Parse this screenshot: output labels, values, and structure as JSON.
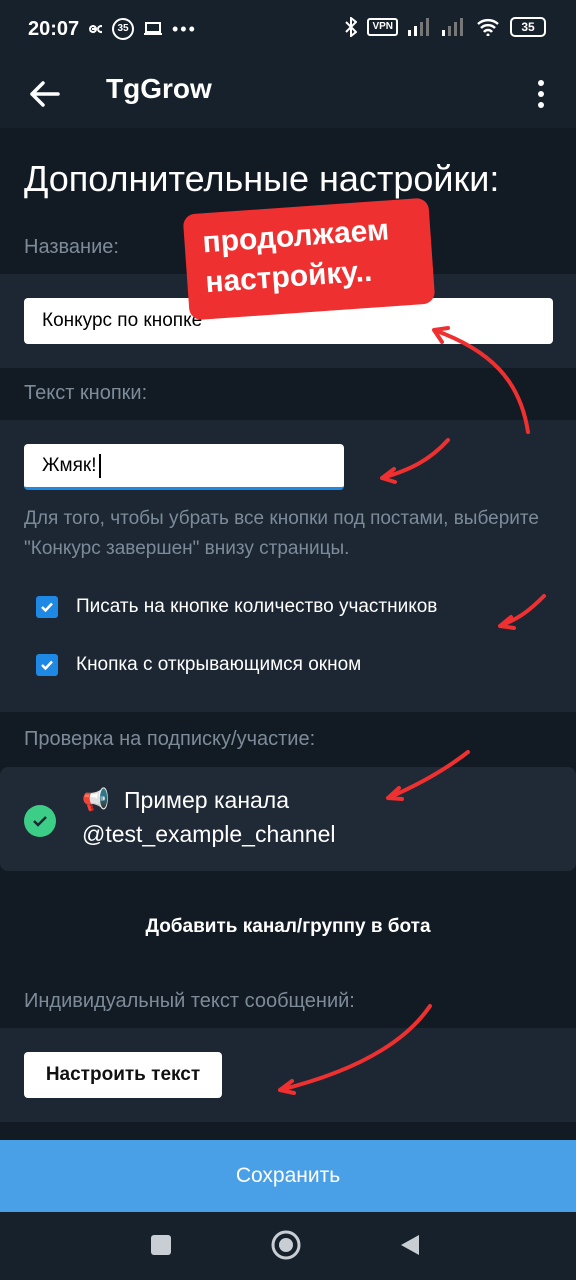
{
  "status_bar": {
    "time": "20:07",
    "notification_count": "35",
    "vpn_label": "VPN",
    "battery": "35"
  },
  "app_bar": {
    "title": "TgGrow"
  },
  "page": {
    "heading": "Дополнительные настройки:",
    "name_label": "Название:",
    "name_value": "Конкурс по кнопке",
    "button_text_label": "Текст кнопки:",
    "button_text_value": "Жмяк!",
    "hint": "Для того, чтобы убрать все кнопки под постами, выберите \"Конкурс завершен\" внизу страницы.",
    "checkboxes": [
      {
        "label": "Писать на кнопке количество участников",
        "checked": true
      },
      {
        "label": "Кнопка с открывающимся окном",
        "checked": true
      }
    ],
    "subscription_label": "Проверка на подписку/участие:",
    "channel": {
      "icon": "📢",
      "name": "Пример канала",
      "handle": "@test_example_channel"
    },
    "add_channel": "Добавить канал/группу в бота",
    "individual_text_label": "Индивидуальный текст сообщений:",
    "configure_text_button": "Настроить текст",
    "save_button": "Сохранить"
  },
  "annotation": {
    "sticker_line1": "продолжаем",
    "sticker_line2": "настройку..",
    "color": "#ef3030"
  },
  "colors": {
    "background": "#121b24",
    "panel": "#1c2733",
    "accent": "#4aa0e6",
    "checkbox": "#1e88e5",
    "success": "#3ccd86"
  }
}
